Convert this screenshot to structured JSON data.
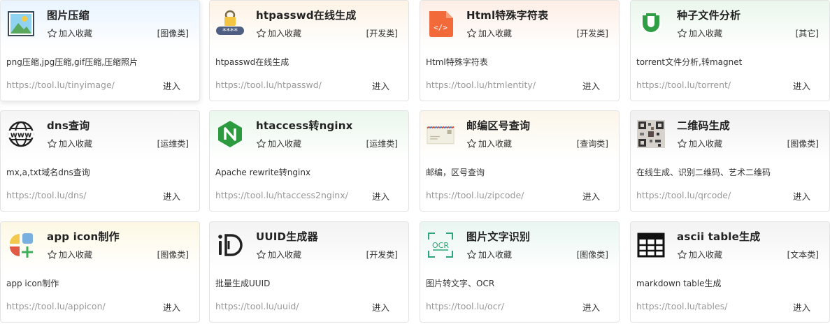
{
  "favorite_label": "加入收藏",
  "enter_label": "进入",
  "tools": [
    {
      "icon": "image-icon",
      "title": "图片压缩",
      "category": "[图像类]",
      "description": "png压缩,jpg压缩,gif压缩,压缩照片",
      "url": "https://tool.lu/tinyimage/",
      "tint": "#e9f4ff"
    },
    {
      "icon": "lock-password-icon",
      "title": "htpasswd在线生成",
      "category": "[开发类]",
      "description": "htpasswd在线生成",
      "url": "https://tool.lu/htpasswd/",
      "tint": "#fdf3e6"
    },
    {
      "icon": "html-file-icon",
      "title": "Html特殊字符表",
      "category": "[开发类]",
      "description": "Html特殊字符表",
      "url": "https://tool.lu/htmlentity/",
      "tint": "#fdeee6"
    },
    {
      "icon": "utorrent-icon",
      "title": "种子文件分析",
      "category": "[其它]",
      "description": "torrent文件分析,转magnet",
      "url": "https://tool.lu/torrent/",
      "tint": "#eaf6ec"
    },
    {
      "icon": "www-globe-icon",
      "title": "dns查询",
      "category": "[运维类]",
      "description": "mx,a,txt域名dns查询",
      "url": "https://tool.lu/dns/",
      "tint": "#f5f5f5"
    },
    {
      "icon": "nginx-icon",
      "title": "htaccess转nginx",
      "category": "[运维类]",
      "description": "Apache rewrite转nginx",
      "url": "https://tool.lu/htaccess2nginx/",
      "tint": "#eaf7ec"
    },
    {
      "icon": "envelope-icon",
      "title": "邮编区号查询",
      "category": "[查询类]",
      "description": "邮编，区号查询",
      "url": "https://tool.lu/zipcode/",
      "tint": "#fbf6ea"
    },
    {
      "icon": "qrcode-icon",
      "title": "二维码生成",
      "category": "[图像类]",
      "description": "在线生成、识别二维码、艺术二维码",
      "url": "https://tool.lu/qrcode/",
      "tint": "#f0f0f0"
    },
    {
      "icon": "app-icon-shapes-icon",
      "title": "app icon制作",
      "category": "[图像类]",
      "description": "app icon制作",
      "url": "https://tool.lu/appicon/",
      "tint": "#fdf8e4"
    },
    {
      "icon": "uuid-id-icon",
      "title": "UUID生成器",
      "category": "[开发类]",
      "description": "批量生成UUID",
      "url": "https://tool.lu/uuid/",
      "tint": "#f3f3f3"
    },
    {
      "icon": "ocr-icon",
      "title": "图片文字识别",
      "category": "[图像类]",
      "description": "图片转文字、OCR",
      "url": "https://tool.lu/ocr/",
      "tint": "#e9f6f1"
    },
    {
      "icon": "table-icon",
      "title": "ascii table生成",
      "category": "[文本类]",
      "description": "markdown table生成",
      "url": "https://tool.lu/tables/",
      "tint": "#f3f3f3"
    }
  ]
}
